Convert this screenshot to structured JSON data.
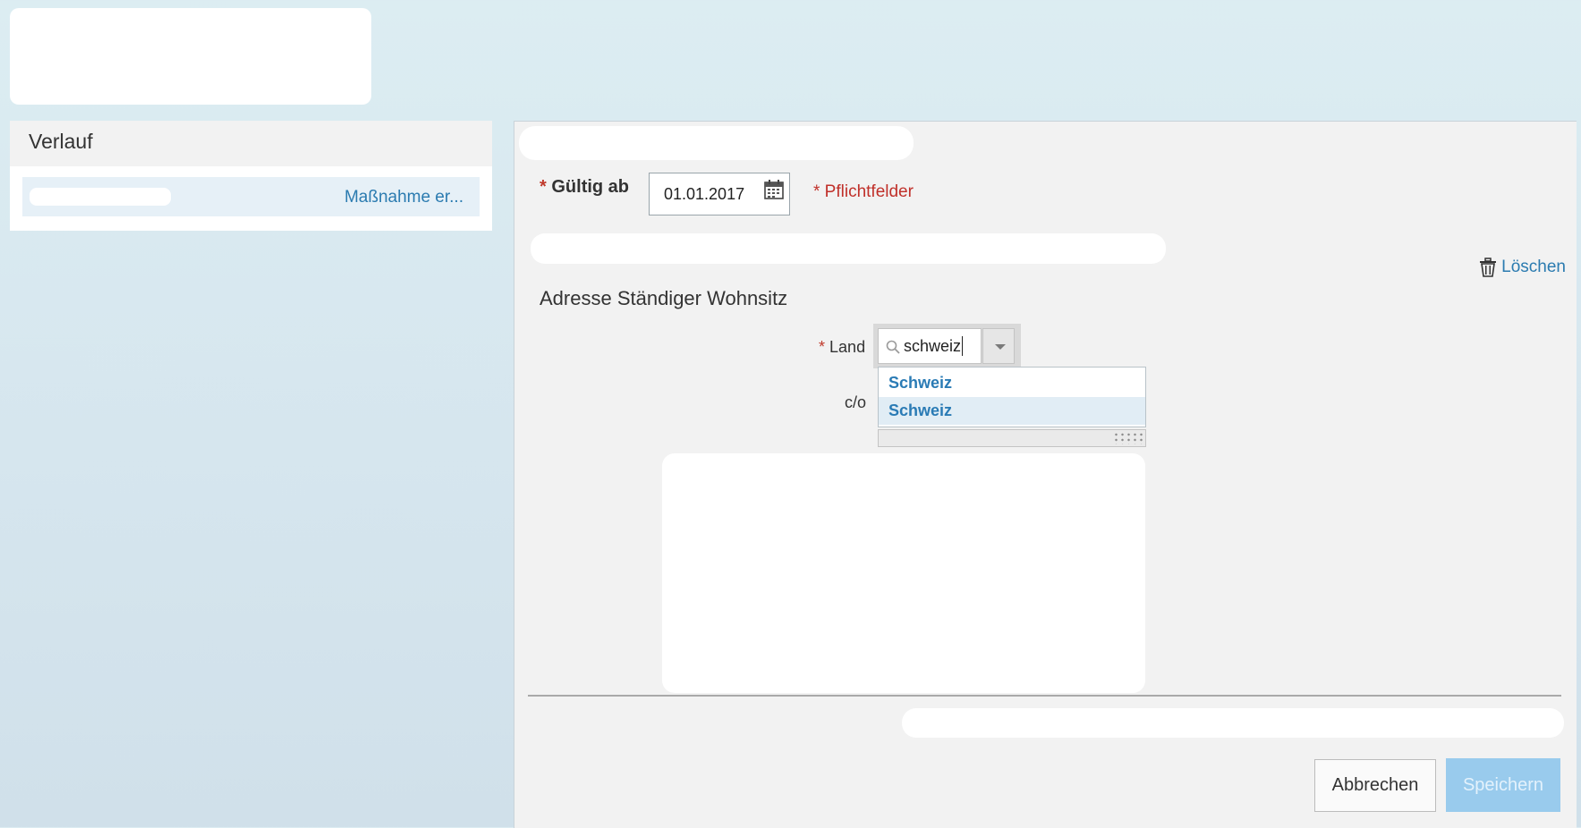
{
  "sidebar": {
    "title": "Verlauf",
    "items": [
      {
        "label": "Maßnahme er..."
      }
    ]
  },
  "form": {
    "valid_from": {
      "required_marker": "*",
      "label": "Gültig ab",
      "value": "01.01.2017"
    },
    "required_note": "* Pflichtfelder",
    "delete_label": "Löschen",
    "section_title": "Adresse Ständiger Wohnsitz",
    "land": {
      "required_marker": "*",
      "label": "Land",
      "value": "schweiz",
      "options": [
        "Schweiz",
        "Schweiz"
      ]
    },
    "co_label": "c/o",
    "cancel_label": "Abbrechen",
    "save_label": "Speichern"
  },
  "icons": {
    "calendar": "calendar-icon",
    "trash": "trash-icon",
    "search": "search-icon",
    "dropdown": "chevron-down-icon",
    "resize": "resize-grip-icon"
  },
  "colors": {
    "accent_link": "#2b7bb0",
    "required": "#c0302a",
    "primary_button_disabled": "#99cbed"
  }
}
